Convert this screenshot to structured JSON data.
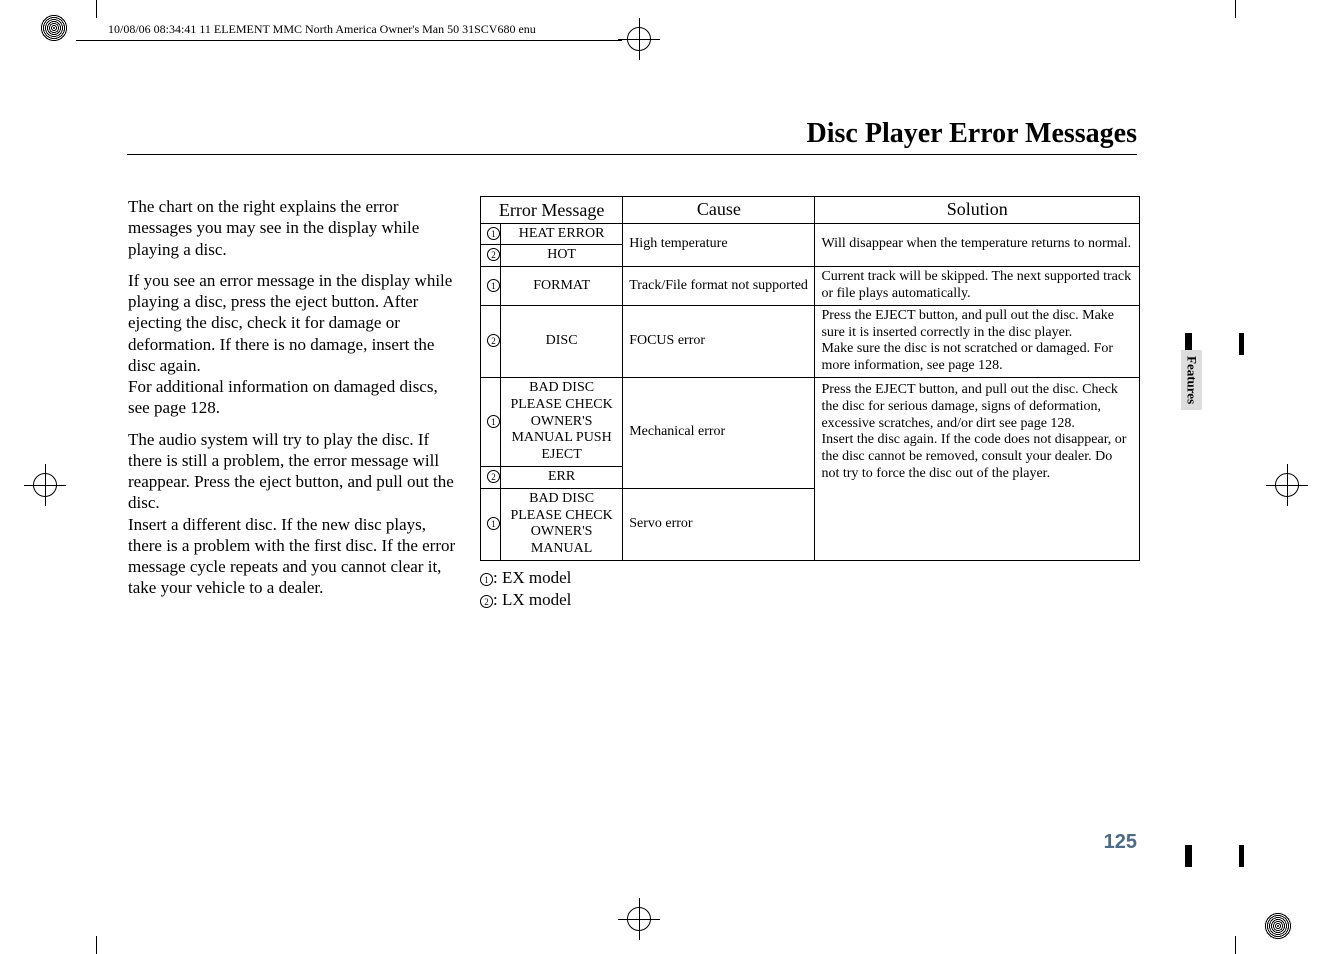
{
  "meta": {
    "header_strip": "10/08/06 08:34:41    11 ELEMENT MMC North America Owner's Man 50 31SCV680 enu"
  },
  "page": {
    "title": "Disc Player Error Messages",
    "side_tab": "Features",
    "page_number": "125"
  },
  "body": {
    "p1": "The chart on the right explains the error messages you may see in the display while playing a disc.",
    "p2a": "If you see an error message in the display while playing a disc, press the eject button. After ejecting the disc, check it for damage or deformation. If there is no damage, insert the disc again.",
    "p2b": "For additional information on damaged discs, see page 128.",
    "p3a": "The audio system will try to play the disc. If there is still a problem, the error message will reappear. Press the eject button, and pull out the disc.",
    "p3b": "Insert a different disc. If the new disc plays, there is a problem with the first disc. If the error message cycle repeats and you cannot clear it, take your vehicle to a dealer."
  },
  "table": {
    "head_error": "Error Message",
    "head_cause": "Cause",
    "head_sol": "Solution",
    "n1": "1",
    "n2": "2",
    "r1_msg1": "HEAT ERROR",
    "r1_msg2": "HOT",
    "r1_cause": "High temperature",
    "r1_sol": "Will disappear when the temperature returns to normal.",
    "r2_msg": "FORMAT",
    "r2_cause": "Track/File format not supported",
    "r2_sol": "Current track will be skipped. The next supported track or file plays automatically.",
    "r3_msg": "DISC",
    "r3_cause": "FOCUS error",
    "r3_sol": "Press the EJECT button, and pull out the disc. Make sure it is inserted correctly in the disc player.\nMake sure the disc is not scratched or damaged. For more information, see page 128.",
    "r4_msg1": "BAD DISC PLEASE CHECK OWNER'S MANUAL PUSH EJECT",
    "r4_msg2": "ERR",
    "r4_cause": "Mechanical error",
    "r45_sol": "Press the EJECT button, and pull out the disc. Check the disc for serious damage, signs of deformation, excessive scratches, and/or dirt see page 128.\nInsert the disc again. If the code does not disappear, or the disc cannot be removed, consult your dealer. Do not try to force the disc out of the player.",
    "r5_msg": "BAD DISC PLEASE CHECK OWNER'S MANUAL",
    "r5_cause": "Servo error"
  },
  "legend": {
    "l1": ": EX model",
    "l2": ": LX model"
  }
}
